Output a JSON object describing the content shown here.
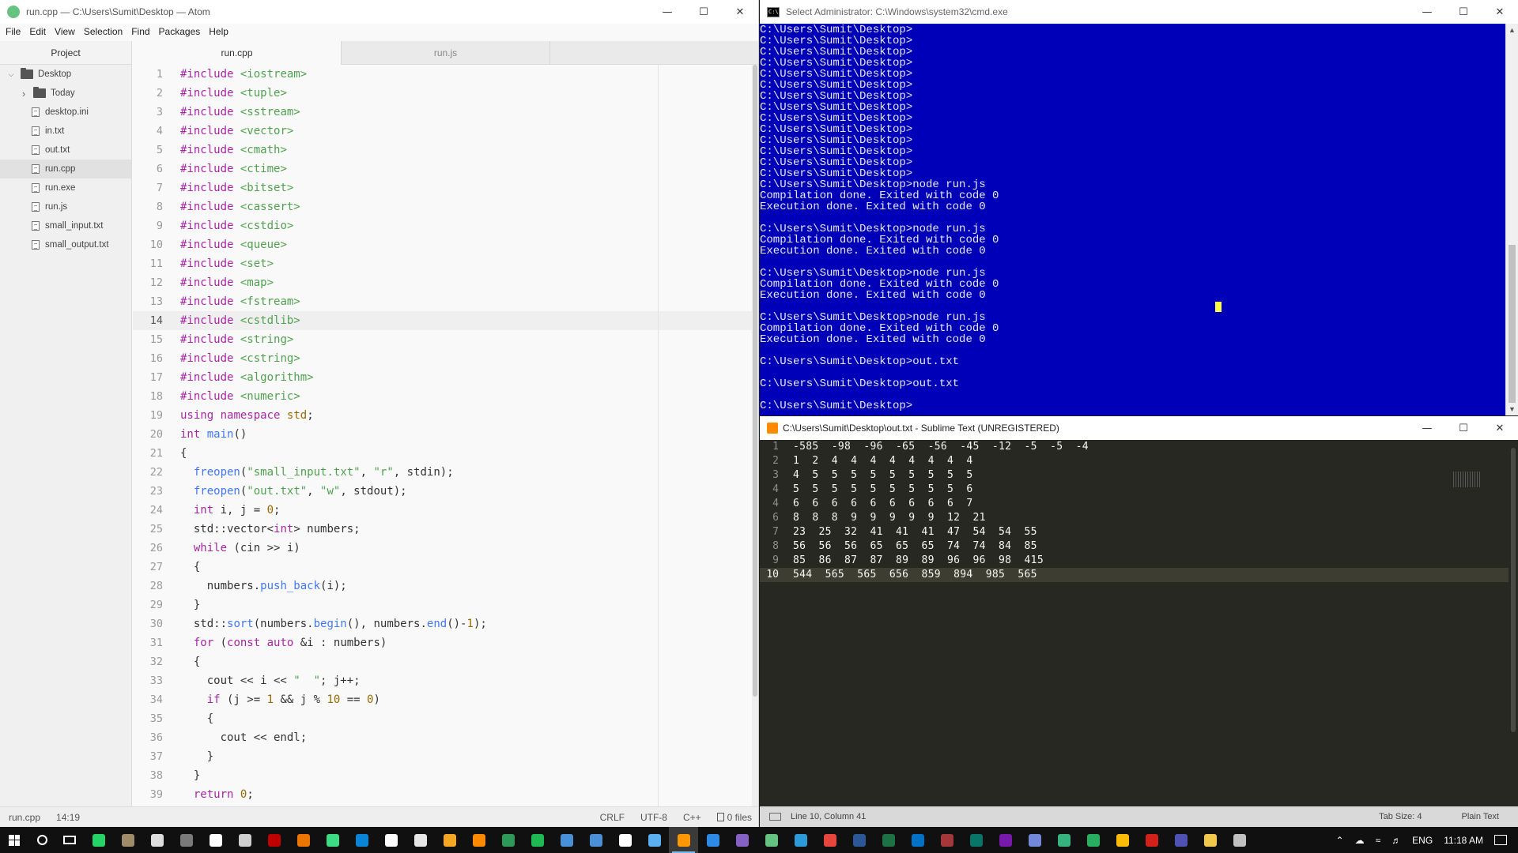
{
  "atom": {
    "title": "run.cpp — C:\\Users\\Sumit\\Desktop — Atom",
    "menu": [
      "File",
      "Edit",
      "View",
      "Selection",
      "Find",
      "Packages",
      "Help"
    ],
    "tree_header": "Project",
    "tree": [
      {
        "label": "Desktop",
        "kind": "folder",
        "expanded": true
      },
      {
        "label": "Today",
        "kind": "folder",
        "expanded": false
      },
      {
        "label": "desktop.ini",
        "kind": "file"
      },
      {
        "label": "in.txt",
        "kind": "file"
      },
      {
        "label": "out.txt",
        "kind": "file"
      },
      {
        "label": "run.cpp",
        "kind": "file",
        "selected": true
      },
      {
        "label": "run.exe",
        "kind": "file"
      },
      {
        "label": "run.js",
        "kind": "file"
      },
      {
        "label": "small_input.txt",
        "kind": "file"
      },
      {
        "label": "small_output.txt",
        "kind": "file"
      }
    ],
    "tabs": [
      {
        "label": "run.cpp",
        "active": true
      },
      {
        "label": "run.js",
        "active": false
      }
    ],
    "current_line": 14,
    "code_lines": [
      "#include <iostream>",
      "#include <tuple>",
      "#include <sstream>",
      "#include <vector>",
      "#include <cmath>",
      "#include <ctime>",
      "#include <bitset>",
      "#include <cassert>",
      "#include <cstdio>",
      "#include <queue>",
      "#include <set>",
      "#include <map>",
      "#include <fstream>",
      "#include <cstdlib>",
      "#include <string>",
      "#include <cstring>",
      "#include <algorithm>",
      "#include <numeric>",
      "using namespace std;",
      "int main()",
      "{",
      "  freopen(\"small_input.txt\", \"r\", stdin);",
      "  freopen(\"out.txt\", \"w\", stdout);",
      "  int i, j = 0;",
      "  std::vector<int> numbers;",
      "  while (cin >> i)",
      "  {",
      "    numbers.push_back(i);",
      "  }",
      "  std::sort(numbers.begin(), numbers.end()-1);",
      "  for (const auto &i : numbers)",
      "  {",
      "    cout << i << \"  \"; j++;",
      "    if (j >= 1 && j % 10 == 0)",
      "    {",
      "      cout << endl;",
      "    }",
      "  }",
      "  return 0;"
    ],
    "status": {
      "file": "run.cpp",
      "cursor": "14:19",
      "line_ending": "CRLF",
      "encoding": "UTF-8",
      "grammar": "C++",
      "git": "0 files"
    }
  },
  "cmd": {
    "title": "Select Administrator: C:\\Windows\\system32\\cmd.exe",
    "lines": [
      "C:\\Users\\Sumit\\Desktop>",
      "C:\\Users\\Sumit\\Desktop>",
      "C:\\Users\\Sumit\\Desktop>",
      "C:\\Users\\Sumit\\Desktop>",
      "C:\\Users\\Sumit\\Desktop>",
      "C:\\Users\\Sumit\\Desktop>",
      "C:\\Users\\Sumit\\Desktop>",
      "C:\\Users\\Sumit\\Desktop>",
      "C:\\Users\\Sumit\\Desktop>",
      "C:\\Users\\Sumit\\Desktop>",
      "C:\\Users\\Sumit\\Desktop>",
      "C:\\Users\\Sumit\\Desktop>",
      "C:\\Users\\Sumit\\Desktop>",
      "C:\\Users\\Sumit\\Desktop>",
      "C:\\Users\\Sumit\\Desktop>node run.js",
      "Compilation done. Exited with code 0",
      "Execution done. Exited with code 0",
      "",
      "C:\\Users\\Sumit\\Desktop>node run.js",
      "Compilation done. Exited with code 0",
      "Execution done. Exited with code 0",
      "",
      "C:\\Users\\Sumit\\Desktop>node run.js",
      "Compilation done. Exited with code 0",
      "Execution done. Exited with code 0",
      "",
      "C:\\Users\\Sumit\\Desktop>node run.js",
      "Compilation done. Exited with code 0",
      "Execution done. Exited with code 0",
      "",
      "C:\\Users\\Sumit\\Desktop>out.txt",
      "",
      "C:\\Users\\Sumit\\Desktop>out.txt",
      "",
      "C:\\Users\\Sumit\\Desktop>"
    ]
  },
  "sublime": {
    "title": "C:\\Users\\Sumit\\Desktop\\out.txt - Sublime Text (UNREGISTERED)",
    "line_numbers": [
      "1",
      "2",
      "3",
      "4",
      "4",
      "6",
      "7",
      "8",
      "9",
      "10"
    ],
    "current_line_index": 9,
    "lines": [
      "-585  -98  -96  -65  -56  -45  -12  -5  -5  -4",
      "1  2  4  4  4  4  4  4  4  4",
      "4  5  5  5  5  5  5  5  5  5",
      "5  5  5  5  5  5  5  5  5  6",
      "6  6  6  6  6  6  6  6  6  7",
      "8  8  8  9  9  9  9  9  12  21",
      "23  25  32  41  41  41  47  54  54  55",
      "56  56  56  65  65  65  74  74  84  85",
      "85  86  87  87  89  89  96  96  98  415",
      "544  565  565  656  859  894  985  565"
    ],
    "status": {
      "position": "Line 10, Column 41",
      "tab_size": "Tab Size: 4",
      "syntax": "Plain Text"
    }
  },
  "taskbar": {
    "apps": [
      {
        "name": "whatsapp-icon",
        "color": "#25d366"
      },
      {
        "name": "gimp-icon",
        "color": "#a08c6a"
      },
      {
        "name": "camera-icon",
        "color": "#dddddd"
      },
      {
        "name": "calculator-icon",
        "color": "#7a7a7a"
      },
      {
        "name": "xbox-icon",
        "color": "#ffffff"
      },
      {
        "name": "paint-icon",
        "color": "#cfcfcf"
      },
      {
        "name": "filezilla-icon",
        "color": "#bf0000"
      },
      {
        "name": "blender-icon",
        "color": "#ea7600"
      },
      {
        "name": "android-studio-icon",
        "color": "#3ddc84"
      },
      {
        "name": "edge-icon",
        "color": "#0a84d6"
      },
      {
        "name": "mail-icon",
        "color": "#ffffff"
      },
      {
        "name": "store-icon",
        "color": "#e6e6e6"
      },
      {
        "name": "orange-app-icon",
        "color": "#f6a623"
      },
      {
        "name": "sublime-icon-small",
        "color": "#ff8a00"
      },
      {
        "name": "drive-icon",
        "color": "#2d9a5a"
      },
      {
        "name": "spotify-icon",
        "color": "#1db954"
      },
      {
        "name": "box-icon",
        "color": "#4a90d9"
      },
      {
        "name": "ms-icon",
        "color": "#4a8fd8"
      },
      {
        "name": "steam-icon",
        "color": "#ffffff"
      },
      {
        "name": "calendar-icon",
        "color": "#5ab0f0"
      },
      {
        "name": "sublime-text-icon",
        "color": "#ff9800",
        "active": true
      },
      {
        "name": "vscode-icon",
        "color": "#2d8ae5"
      },
      {
        "name": "visual-studio-icon",
        "color": "#8661c5"
      },
      {
        "name": "atom-icon",
        "color": "#66c280"
      },
      {
        "name": "sync-icon",
        "color": "#2b9cd8"
      },
      {
        "name": "chrome-icon",
        "color": "#e8453c"
      },
      {
        "name": "word-icon",
        "color": "#2b5797"
      },
      {
        "name": "excel-icon",
        "color": "#1e7145"
      },
      {
        "name": "outlook-icon",
        "color": "#0072c6"
      },
      {
        "name": "access-icon",
        "color": "#a4373a"
      },
      {
        "name": "publisher-icon",
        "color": "#077568"
      },
      {
        "name": "onenote-icon",
        "color": "#7719aa"
      },
      {
        "name": "discord-icon",
        "color": "#7289da"
      },
      {
        "name": "greenshot-icon",
        "color": "#36b37e"
      },
      {
        "name": "xmind-icon",
        "color": "#27ae60"
      },
      {
        "name": "chrome2-icon",
        "color": "#fbbc05"
      },
      {
        "name": "acrobat-icon",
        "color": "#d4201a"
      },
      {
        "name": "teams-icon",
        "color": "#4f52b2"
      },
      {
        "name": "explorer-icon",
        "color": "#f2c84b"
      },
      {
        "name": "cmd-icon",
        "color": "#c0c0c0"
      }
    ],
    "language": "ENG",
    "time": "11:18 AM"
  }
}
